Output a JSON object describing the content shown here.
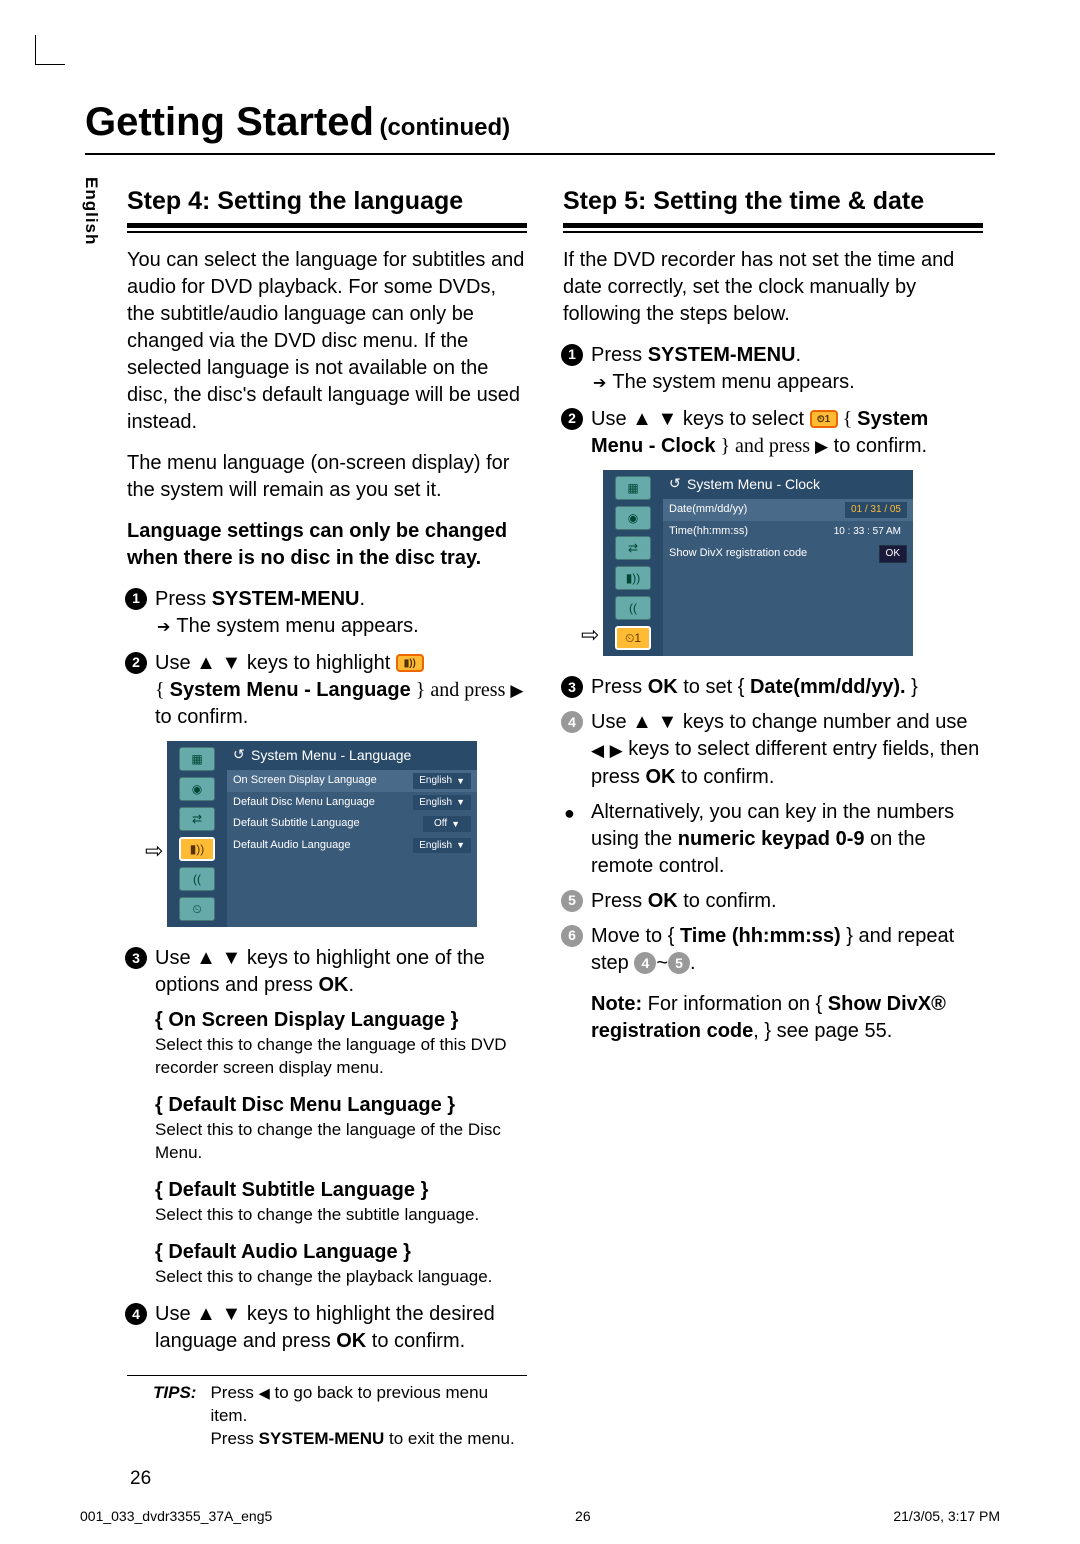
{
  "page": {
    "title_main": "Getting Started",
    "title_cont": "(continued)",
    "language_tab": "English",
    "page_number": "26"
  },
  "step4": {
    "heading": "Step 4: Setting the language",
    "para1": "You can select the language for subtitles and audio for DVD playback. For some DVDs, the subtitle/audio language can only be changed via the DVD disc menu. If the selected language is not available on the disc, the disc's default language will be used instead.",
    "para2": "The menu language (on-screen display) for the system will remain as you set it.",
    "para3": "Language settings can only be changed when there is no disc in the disc tray.",
    "s1a": "Press ",
    "s1b": "SYSTEM-MENU",
    "s1c": ".",
    "s1_sub": "The system menu appears.",
    "s2a": "Use ",
    "s2b": " keys to highlight ",
    "s2c": "{ ",
    "s2d": "System Menu - Language",
    "s2e": " } and press ",
    "s2f": " to confirm.",
    "s3a": "Use ",
    "s3b": " keys to highlight one of the options and press ",
    "s3c": "OK",
    "s3d": ".",
    "opt1_t": "{ On Screen Display Language }",
    "opt1_d": "Select this to change the language of this DVD recorder screen display menu.",
    "opt2_t": "{ Default Disc Menu Language }",
    "opt2_d": "Select this to change the language of the Disc Menu.",
    "opt3_t": "{ Default Subtitle Language }",
    "opt3_d": "Select this to change the subtitle language.",
    "opt4_t": "{ Default  Audio Language }",
    "opt4_d": "Select this to change the playback language.",
    "s4a": "Use ",
    "s4b": " keys to highlight the desired language and press ",
    "s4c": "OK",
    "s4d": " to confirm.",
    "osd": {
      "title": "System Menu - Language",
      "rows": [
        {
          "label": "On Screen Display Language",
          "value": "English"
        },
        {
          "label": "Default Disc Menu Language",
          "value": "English"
        },
        {
          "label": "Default Subtitle Language",
          "value": "Off"
        },
        {
          "label": "Default Audio Language",
          "value": "English"
        }
      ]
    }
  },
  "step5": {
    "heading": "Step 5: Setting the time & date",
    "para1": "If the DVD recorder has not set the time and date correctly, set the clock manually by following the steps below.",
    "s1a": "Press ",
    "s1b": "SYSTEM-MENU",
    "s1c": ".",
    "s1_sub": "The system menu appears.",
    "s2a": "Use ",
    "s2b": " keys to select ",
    "s2c": " { ",
    "s2d": "System Menu - Clock",
    "s2e": " } and press ",
    "s2f": " to confirm.",
    "s3a": "Press ",
    "s3b": "OK",
    "s3c": " to set { ",
    "s3d": "Date(mm/dd/yy).",
    "s3e": " }",
    "s4a": "Use ",
    "s4b": " keys to change number and use ",
    "s4c": " keys to select different entry fields, then press ",
    "s4d": "OK",
    "s4e": " to confirm.",
    "alt_a": "Alternatively, you can key in the numbers using the ",
    "alt_b": "numeric keypad 0-9",
    "alt_c": " on the remote control.",
    "s5a": "Press ",
    "s5b": "OK",
    "s5c": " to confirm.",
    "s6a": "Move to { ",
    "s6b": "Time (hh:mm:ss)",
    "s6c": " } and repeat step ",
    "s6d": "~",
    "s6e": ".",
    "note_a": "Note:",
    "note_b": "  For information on { ",
    "note_c": "Show DivX® registration code",
    "note_d": ", } see page 55.",
    "osd": {
      "title": "System Menu - Clock",
      "rows": [
        {
          "label": "Date(mm/dd/yy)",
          "value": "01 / 31 / 05"
        },
        {
          "label": "Time(hh:mm:ss)",
          "value": "10 : 33 : 57 AM"
        },
        {
          "label": "Show DivX registration code",
          "value": "OK"
        }
      ]
    }
  },
  "tips": {
    "label": "TIPS:",
    "line1a": "Press ",
    "line1b": " to go back to previous menu item.",
    "line2a": "Press ",
    "line2b": "SYSTEM-MENU",
    "line2c": " to exit the menu."
  },
  "footer": {
    "file": "001_033_dvdr3355_37A_eng5",
    "center": "26",
    "timestamp": "21/3/05, 3:17 PM"
  }
}
